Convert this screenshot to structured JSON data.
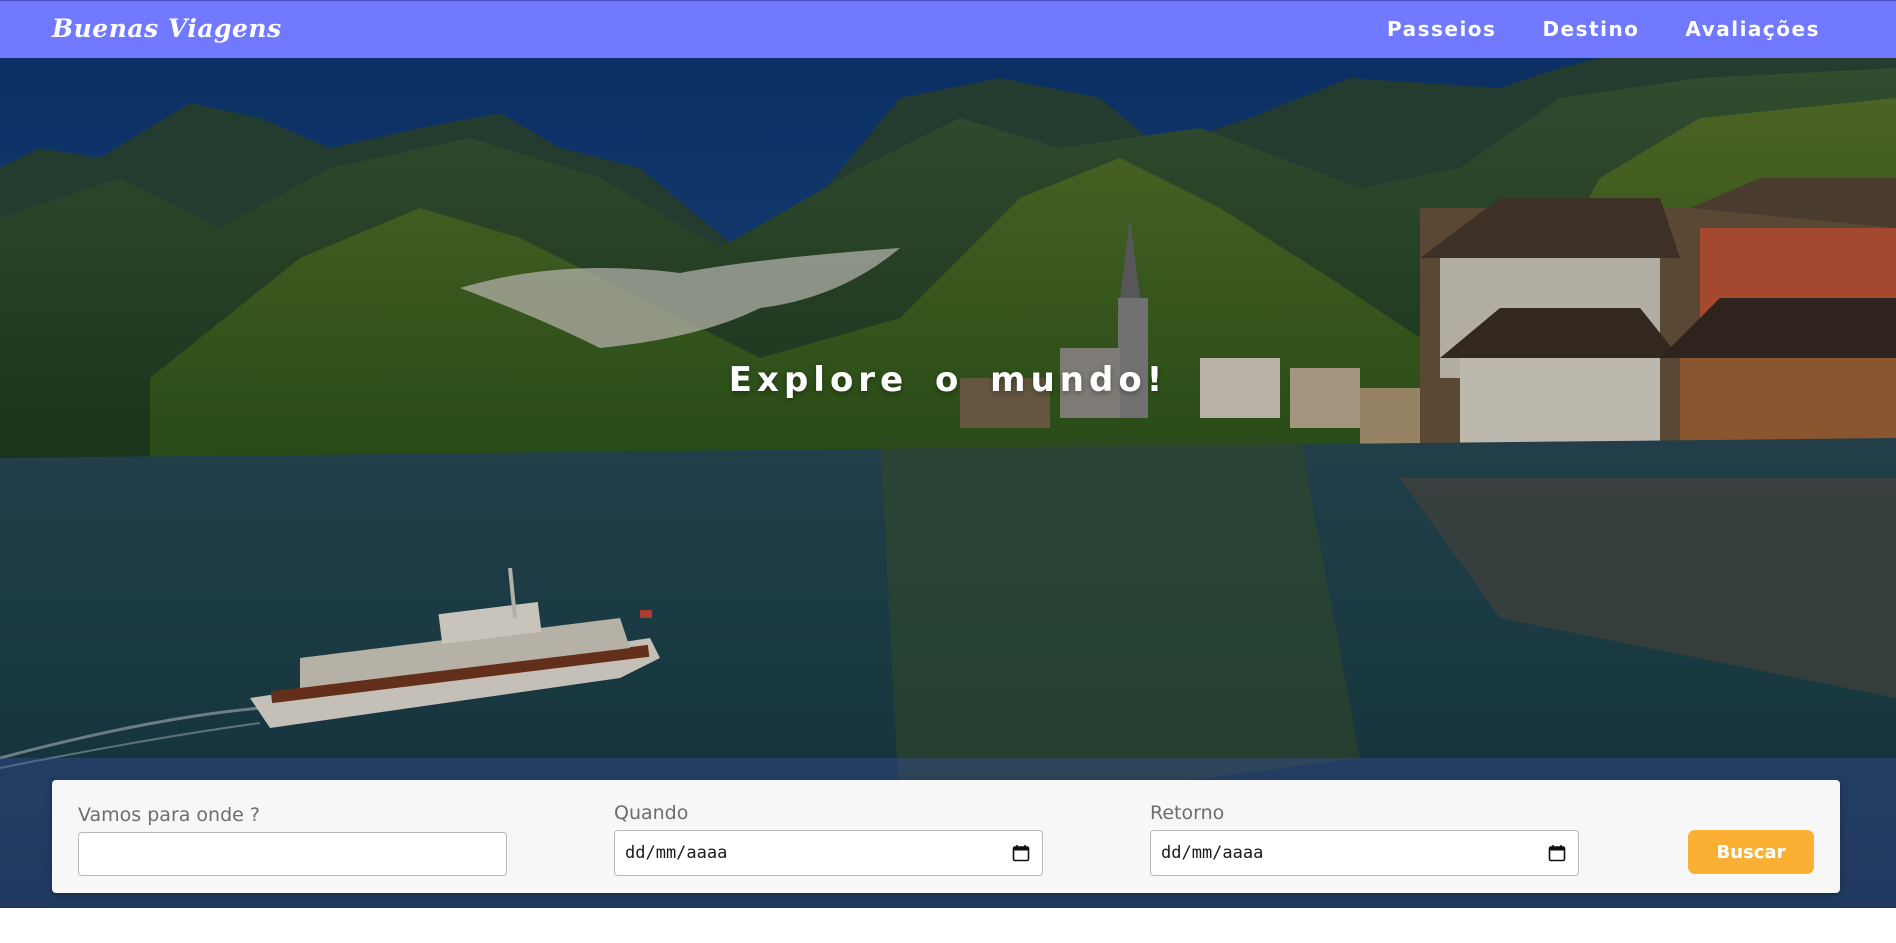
{
  "navbar": {
    "brand": "Buenas Viagens",
    "links": [
      "Passeios",
      "Destino",
      "Avaliações"
    ]
  },
  "hero": {
    "title": "Explore  o  mundo!"
  },
  "search": {
    "destination_label": "Vamos para onde ?",
    "destination_value": "",
    "when_label": "Quando",
    "when_value": "dd/mm/aaaa",
    "return_label": "Retorno",
    "return_value": "dd/mm/aaaa",
    "button_label": "Buscar"
  },
  "colors": {
    "navbar_bg": "#7079ff",
    "button_bg": "#fbb033",
    "panel_bg": "#f7f7f8"
  },
  "icons": [
    "calendar-icon"
  ]
}
